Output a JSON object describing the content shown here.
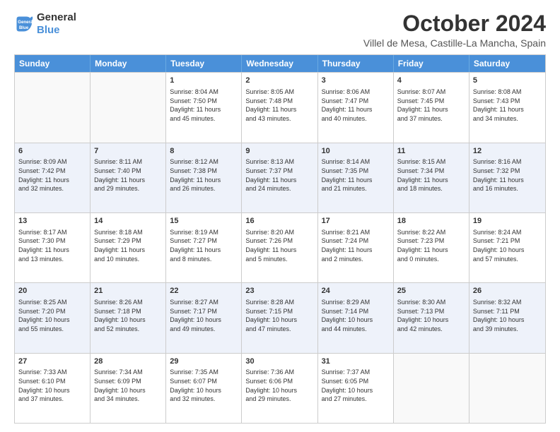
{
  "logo": {
    "line1": "General",
    "line2": "Blue"
  },
  "header": {
    "month": "October 2024",
    "location": "Villel de Mesa, Castille-La Mancha, Spain"
  },
  "weekdays": [
    "Sunday",
    "Monday",
    "Tuesday",
    "Wednesday",
    "Thursday",
    "Friday",
    "Saturday"
  ],
  "rows": [
    {
      "alt": false,
      "cells": [
        {
          "day": "",
          "lines": []
        },
        {
          "day": "",
          "lines": []
        },
        {
          "day": "1",
          "lines": [
            "Sunrise: 8:04 AM",
            "Sunset: 7:50 PM",
            "Daylight: 11 hours",
            "and 45 minutes."
          ]
        },
        {
          "day": "2",
          "lines": [
            "Sunrise: 8:05 AM",
            "Sunset: 7:48 PM",
            "Daylight: 11 hours",
            "and 43 minutes."
          ]
        },
        {
          "day": "3",
          "lines": [
            "Sunrise: 8:06 AM",
            "Sunset: 7:47 PM",
            "Daylight: 11 hours",
            "and 40 minutes."
          ]
        },
        {
          "day": "4",
          "lines": [
            "Sunrise: 8:07 AM",
            "Sunset: 7:45 PM",
            "Daylight: 11 hours",
            "and 37 minutes."
          ]
        },
        {
          "day": "5",
          "lines": [
            "Sunrise: 8:08 AM",
            "Sunset: 7:43 PM",
            "Daylight: 11 hours",
            "and 34 minutes."
          ]
        }
      ]
    },
    {
      "alt": true,
      "cells": [
        {
          "day": "6",
          "lines": [
            "Sunrise: 8:09 AM",
            "Sunset: 7:42 PM",
            "Daylight: 11 hours",
            "and 32 minutes."
          ]
        },
        {
          "day": "7",
          "lines": [
            "Sunrise: 8:11 AM",
            "Sunset: 7:40 PM",
            "Daylight: 11 hours",
            "and 29 minutes."
          ]
        },
        {
          "day": "8",
          "lines": [
            "Sunrise: 8:12 AM",
            "Sunset: 7:38 PM",
            "Daylight: 11 hours",
            "and 26 minutes."
          ]
        },
        {
          "day": "9",
          "lines": [
            "Sunrise: 8:13 AM",
            "Sunset: 7:37 PM",
            "Daylight: 11 hours",
            "and 24 minutes."
          ]
        },
        {
          "day": "10",
          "lines": [
            "Sunrise: 8:14 AM",
            "Sunset: 7:35 PM",
            "Daylight: 11 hours",
            "and 21 minutes."
          ]
        },
        {
          "day": "11",
          "lines": [
            "Sunrise: 8:15 AM",
            "Sunset: 7:34 PM",
            "Daylight: 11 hours",
            "and 18 minutes."
          ]
        },
        {
          "day": "12",
          "lines": [
            "Sunrise: 8:16 AM",
            "Sunset: 7:32 PM",
            "Daylight: 11 hours",
            "and 16 minutes."
          ]
        }
      ]
    },
    {
      "alt": false,
      "cells": [
        {
          "day": "13",
          "lines": [
            "Sunrise: 8:17 AM",
            "Sunset: 7:30 PM",
            "Daylight: 11 hours",
            "and 13 minutes."
          ]
        },
        {
          "day": "14",
          "lines": [
            "Sunrise: 8:18 AM",
            "Sunset: 7:29 PM",
            "Daylight: 11 hours",
            "and 10 minutes."
          ]
        },
        {
          "day": "15",
          "lines": [
            "Sunrise: 8:19 AM",
            "Sunset: 7:27 PM",
            "Daylight: 11 hours",
            "and 8 minutes."
          ]
        },
        {
          "day": "16",
          "lines": [
            "Sunrise: 8:20 AM",
            "Sunset: 7:26 PM",
            "Daylight: 11 hours",
            "and 5 minutes."
          ]
        },
        {
          "day": "17",
          "lines": [
            "Sunrise: 8:21 AM",
            "Sunset: 7:24 PM",
            "Daylight: 11 hours",
            "and 2 minutes."
          ]
        },
        {
          "day": "18",
          "lines": [
            "Sunrise: 8:22 AM",
            "Sunset: 7:23 PM",
            "Daylight: 11 hours",
            "and 0 minutes."
          ]
        },
        {
          "day": "19",
          "lines": [
            "Sunrise: 8:24 AM",
            "Sunset: 7:21 PM",
            "Daylight: 10 hours",
            "and 57 minutes."
          ]
        }
      ]
    },
    {
      "alt": true,
      "cells": [
        {
          "day": "20",
          "lines": [
            "Sunrise: 8:25 AM",
            "Sunset: 7:20 PM",
            "Daylight: 10 hours",
            "and 55 minutes."
          ]
        },
        {
          "day": "21",
          "lines": [
            "Sunrise: 8:26 AM",
            "Sunset: 7:18 PM",
            "Daylight: 10 hours",
            "and 52 minutes."
          ]
        },
        {
          "day": "22",
          "lines": [
            "Sunrise: 8:27 AM",
            "Sunset: 7:17 PM",
            "Daylight: 10 hours",
            "and 49 minutes."
          ]
        },
        {
          "day": "23",
          "lines": [
            "Sunrise: 8:28 AM",
            "Sunset: 7:15 PM",
            "Daylight: 10 hours",
            "and 47 minutes."
          ]
        },
        {
          "day": "24",
          "lines": [
            "Sunrise: 8:29 AM",
            "Sunset: 7:14 PM",
            "Daylight: 10 hours",
            "and 44 minutes."
          ]
        },
        {
          "day": "25",
          "lines": [
            "Sunrise: 8:30 AM",
            "Sunset: 7:13 PM",
            "Daylight: 10 hours",
            "and 42 minutes."
          ]
        },
        {
          "day": "26",
          "lines": [
            "Sunrise: 8:32 AM",
            "Sunset: 7:11 PM",
            "Daylight: 10 hours",
            "and 39 minutes."
          ]
        }
      ]
    },
    {
      "alt": false,
      "cells": [
        {
          "day": "27",
          "lines": [
            "Sunrise: 7:33 AM",
            "Sunset: 6:10 PM",
            "Daylight: 10 hours",
            "and 37 minutes."
          ]
        },
        {
          "day": "28",
          "lines": [
            "Sunrise: 7:34 AM",
            "Sunset: 6:09 PM",
            "Daylight: 10 hours",
            "and 34 minutes."
          ]
        },
        {
          "day": "29",
          "lines": [
            "Sunrise: 7:35 AM",
            "Sunset: 6:07 PM",
            "Daylight: 10 hours",
            "and 32 minutes."
          ]
        },
        {
          "day": "30",
          "lines": [
            "Sunrise: 7:36 AM",
            "Sunset: 6:06 PM",
            "Daylight: 10 hours",
            "and 29 minutes."
          ]
        },
        {
          "day": "31",
          "lines": [
            "Sunrise: 7:37 AM",
            "Sunset: 6:05 PM",
            "Daylight: 10 hours",
            "and 27 minutes."
          ]
        },
        {
          "day": "",
          "lines": []
        },
        {
          "day": "",
          "lines": []
        }
      ]
    }
  ]
}
